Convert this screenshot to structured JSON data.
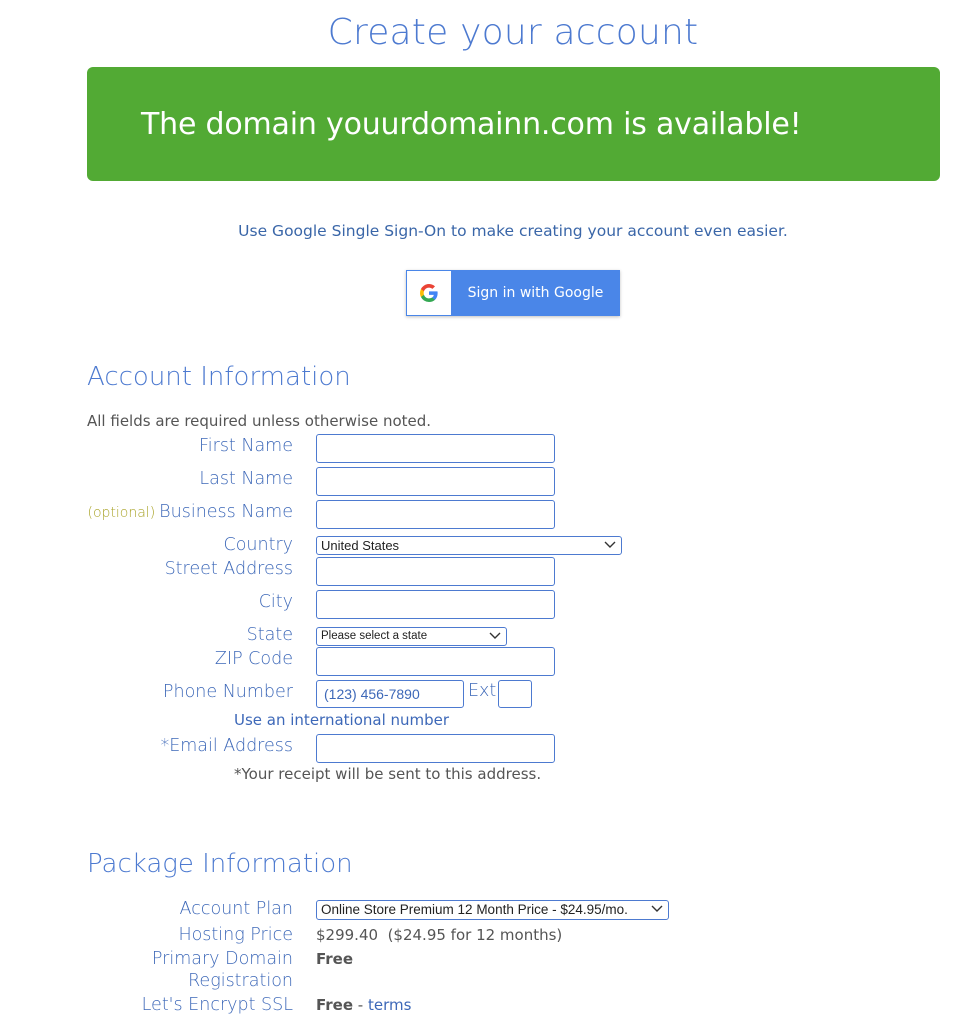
{
  "header": {
    "title": "Create your account"
  },
  "banner": {
    "text": "The domain youurdomainn.com is available!"
  },
  "sso": {
    "prompt": "Use Google Single Sign-On to make creating your account even easier.",
    "button_label": "Sign in with Google"
  },
  "account": {
    "title": "Account Information",
    "note": "All fields are required unless otherwise noted.",
    "fields": {
      "first_name": {
        "label": "First Name",
        "value": ""
      },
      "last_name": {
        "label": "Last Name",
        "value": ""
      },
      "business_name": {
        "optional": "(optional)",
        "label": "Business Name",
        "value": ""
      },
      "country": {
        "label": "Country",
        "selected": "United States"
      },
      "street": {
        "label": "Street Address",
        "value": ""
      },
      "city": {
        "label": "City",
        "value": ""
      },
      "state": {
        "label": "State",
        "selected": "Please select a state"
      },
      "zip": {
        "label": "ZIP Code",
        "value": ""
      },
      "phone": {
        "label": "Phone Number",
        "value": "(123) 456-7890",
        "ext_label": "Ext",
        "ext_value": ""
      },
      "intl_link": "Use an international number",
      "email": {
        "label": "*Email Address",
        "value": ""
      },
      "receipt_note": "*Your receipt will be sent to this address."
    }
  },
  "package": {
    "title": "Package Information",
    "plan": {
      "label": "Account Plan",
      "selected": "Online Store Premium 12 Month Price - $24.95/mo."
    },
    "hosting_price": {
      "label": "Hosting Price",
      "value": "$299.40  ($24.95 for 12 months)"
    },
    "domain": {
      "label_line1": "Primary Domain",
      "label_line2": "Registration",
      "value": "Free"
    },
    "ssl": {
      "label": "Let's Encrypt SSL",
      "value": "Free",
      "separator": " - ",
      "link": "terms"
    }
  },
  "colors": {
    "banner": "#52aa34",
    "accent": "#4d7ad0",
    "google_button": "#4a86e8",
    "optional": "#a9a327"
  },
  "icons": {
    "google": "google-g-icon",
    "dropdown": "chevron-down-icon"
  }
}
